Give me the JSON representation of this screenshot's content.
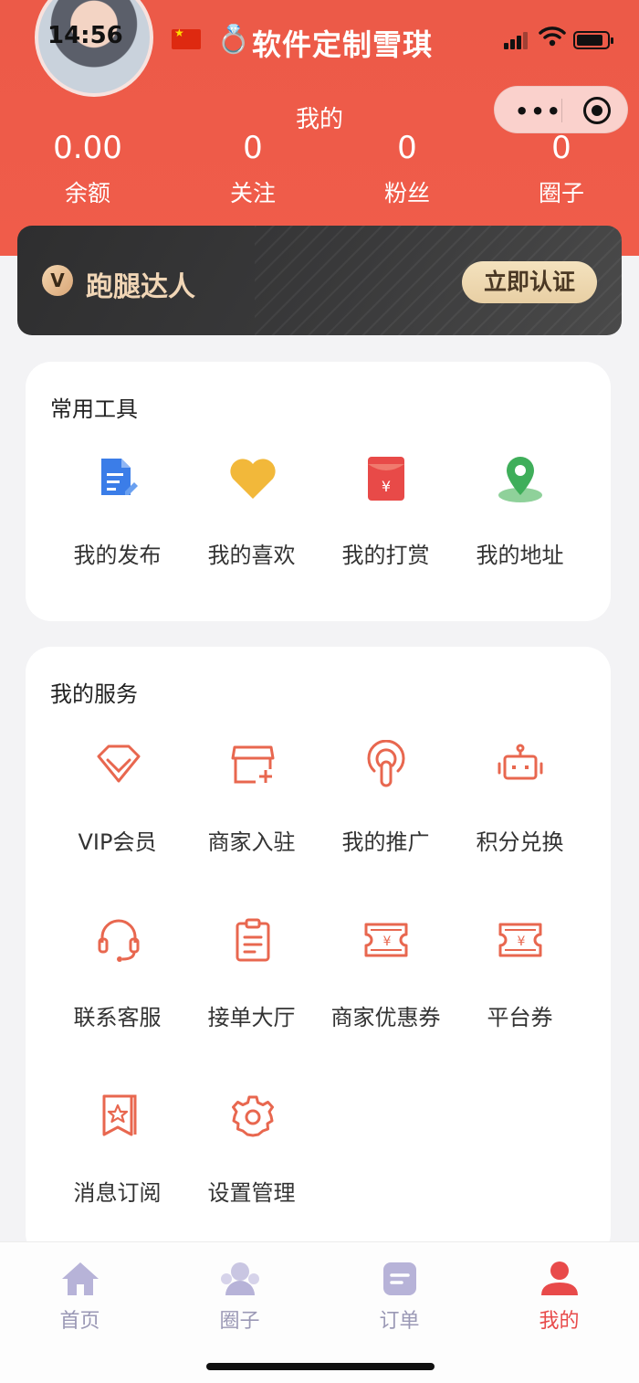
{
  "status_bar": {
    "time": "14:56",
    "carrier_title": "软件定制雪琪"
  },
  "page": {
    "title": "我的"
  },
  "stats": [
    {
      "value": "0.00",
      "label": "余额"
    },
    {
      "value": "0",
      "label": "关注"
    },
    {
      "value": "0",
      "label": "粉丝"
    },
    {
      "value": "0",
      "label": "圈子"
    }
  ],
  "vip_card": {
    "badge": "V",
    "title": "跑腿达人",
    "action": "立即认证"
  },
  "common_tools": {
    "title": "常用工具",
    "items": [
      {
        "label": "我的发布",
        "icon": "document-edit-icon"
      },
      {
        "label": "我的喜欢",
        "icon": "heart-icon"
      },
      {
        "label": "我的打赏",
        "icon": "red-envelope-icon"
      },
      {
        "label": "我的地址",
        "icon": "location-pin-icon"
      }
    ]
  },
  "services": {
    "title": "我的服务",
    "items": [
      {
        "label": "VIP会员",
        "icon": "diamond-icon"
      },
      {
        "label": "商家入驻",
        "icon": "storefront-icon"
      },
      {
        "label": "我的推广",
        "icon": "broadcast-icon"
      },
      {
        "label": "积分兑换",
        "icon": "robot-icon"
      },
      {
        "label": "联系客服",
        "icon": "headset-icon"
      },
      {
        "label": "接单大厅",
        "icon": "clipboard-icon"
      },
      {
        "label": "商家优惠券",
        "icon": "coupon-icon"
      },
      {
        "label": "平台券",
        "icon": "coupon-icon"
      },
      {
        "label": "消息订阅",
        "icon": "bookmark-star-icon"
      },
      {
        "label": "设置管理",
        "icon": "gear-icon"
      }
    ]
  },
  "tabbar": {
    "items": [
      {
        "label": "首页",
        "icon": "home-icon"
      },
      {
        "label": "圈子",
        "icon": "group-icon"
      },
      {
        "label": "订单",
        "icon": "order-icon"
      },
      {
        "label": "我的",
        "icon": "user-icon",
        "active": true
      }
    ]
  },
  "colors": {
    "header": "#ec5a48",
    "service_icon": "#e8674f",
    "active_tab": "#e84a4a",
    "inactive_tab": "#9a98b5"
  }
}
